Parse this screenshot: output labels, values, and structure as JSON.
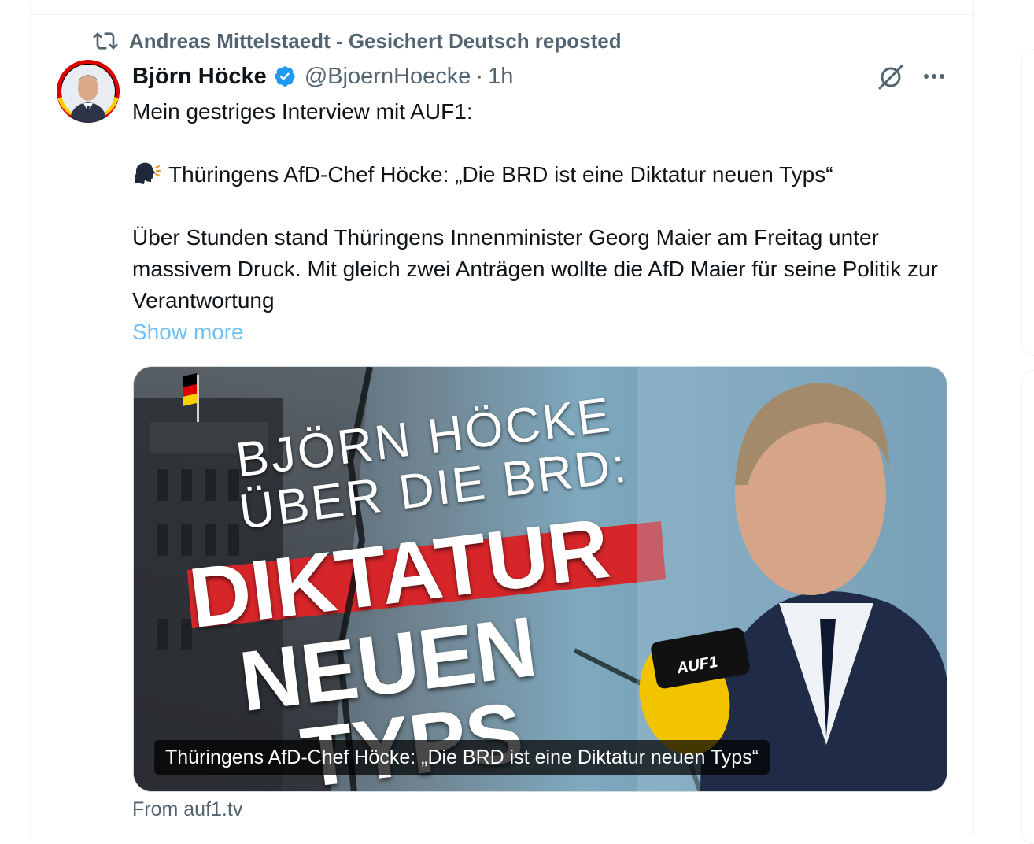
{
  "repost": {
    "label": "Andreas Mittelstaedt - Gesichert Deutsch reposted",
    "icon": "repost-icon"
  },
  "post": {
    "author_name": "Björn Höcke",
    "verified": true,
    "handle": "@BjoernHoecke",
    "separator": "·",
    "time": "1h",
    "body": {
      "line1": "Mein gestriges Interview mit AUF1:",
      "line2": "Thüringens AfD-Chef Höcke: „Die BRD ist eine Diktatur neuen Typs“",
      "line3": "Über Stunden stand Thüringens Innenminister Georg Maier am Freitag unter massivem Druck. Mit gleich zwei Anträgen wollte die AfD Maier für seine Politik zur Verantwortung",
      "show_more": "Show more"
    },
    "media": {
      "headline_line1": "BJÖRN HÖCKE",
      "headline_line2": "ÜBER DIE BRD:",
      "headline_line3": "DIKTATUR",
      "headline_line4": "NEUEN",
      "headline_line5": "TYPS",
      "mic_label": "AUF1",
      "caption": "Thüringens AfD-Chef Höcke: „Die BRD ist eine Diktatur neuen Typs“"
    },
    "source": "From auf1.tv"
  },
  "colors": {
    "text_primary": "#0f1419",
    "text_secondary": "#536471",
    "accent": "#1d9bf0",
    "border": "#eff3f4"
  }
}
